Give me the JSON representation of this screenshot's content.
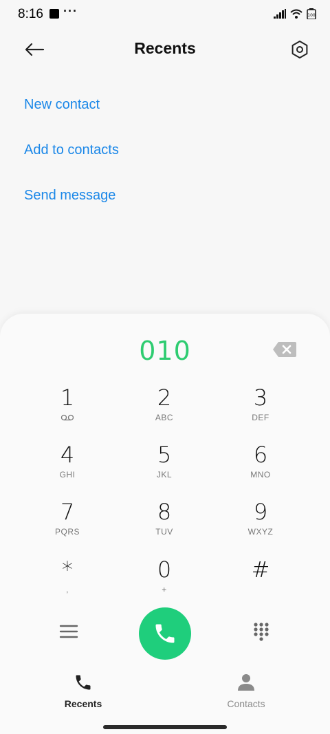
{
  "status_bar": {
    "time": "8:16",
    "dots": "···",
    "battery": "100"
  },
  "header": {
    "title": "Recents"
  },
  "actions": [
    {
      "label": "New contact"
    },
    {
      "label": "Add to contacts"
    },
    {
      "label": "Send message"
    }
  ],
  "dialer": {
    "number": "010",
    "keys": [
      {
        "digit": "1",
        "letters": ""
      },
      {
        "digit": "2",
        "letters": "ABC"
      },
      {
        "digit": "3",
        "letters": "DEF"
      },
      {
        "digit": "4",
        "letters": "GHI"
      },
      {
        "digit": "5",
        "letters": "JKL"
      },
      {
        "digit": "6",
        "letters": "MNO"
      },
      {
        "digit": "7",
        "letters": "PQRS"
      },
      {
        "digit": "8",
        "letters": "TUV"
      },
      {
        "digit": "9",
        "letters": "WXYZ"
      },
      {
        "digit": "*",
        "letters": ","
      },
      {
        "digit": "0",
        "letters": "+"
      },
      {
        "digit": "#",
        "letters": ""
      }
    ]
  },
  "bottom_nav": [
    {
      "label": "Recents",
      "active": true
    },
    {
      "label": "Contacts",
      "active": false
    }
  ],
  "colors": {
    "accent": "#1a87e8",
    "call_green": "#1fce7c",
    "number_green": "#2ecc71"
  },
  "icons": [
    "back-arrow-icon",
    "settings-icon",
    "backspace-icon",
    "voicemail-icon",
    "menu-icon",
    "phone-icon",
    "dialpad-icon",
    "recents-phone-icon",
    "contacts-person-icon",
    "signal-icon",
    "wifi-icon",
    "battery-icon"
  ]
}
